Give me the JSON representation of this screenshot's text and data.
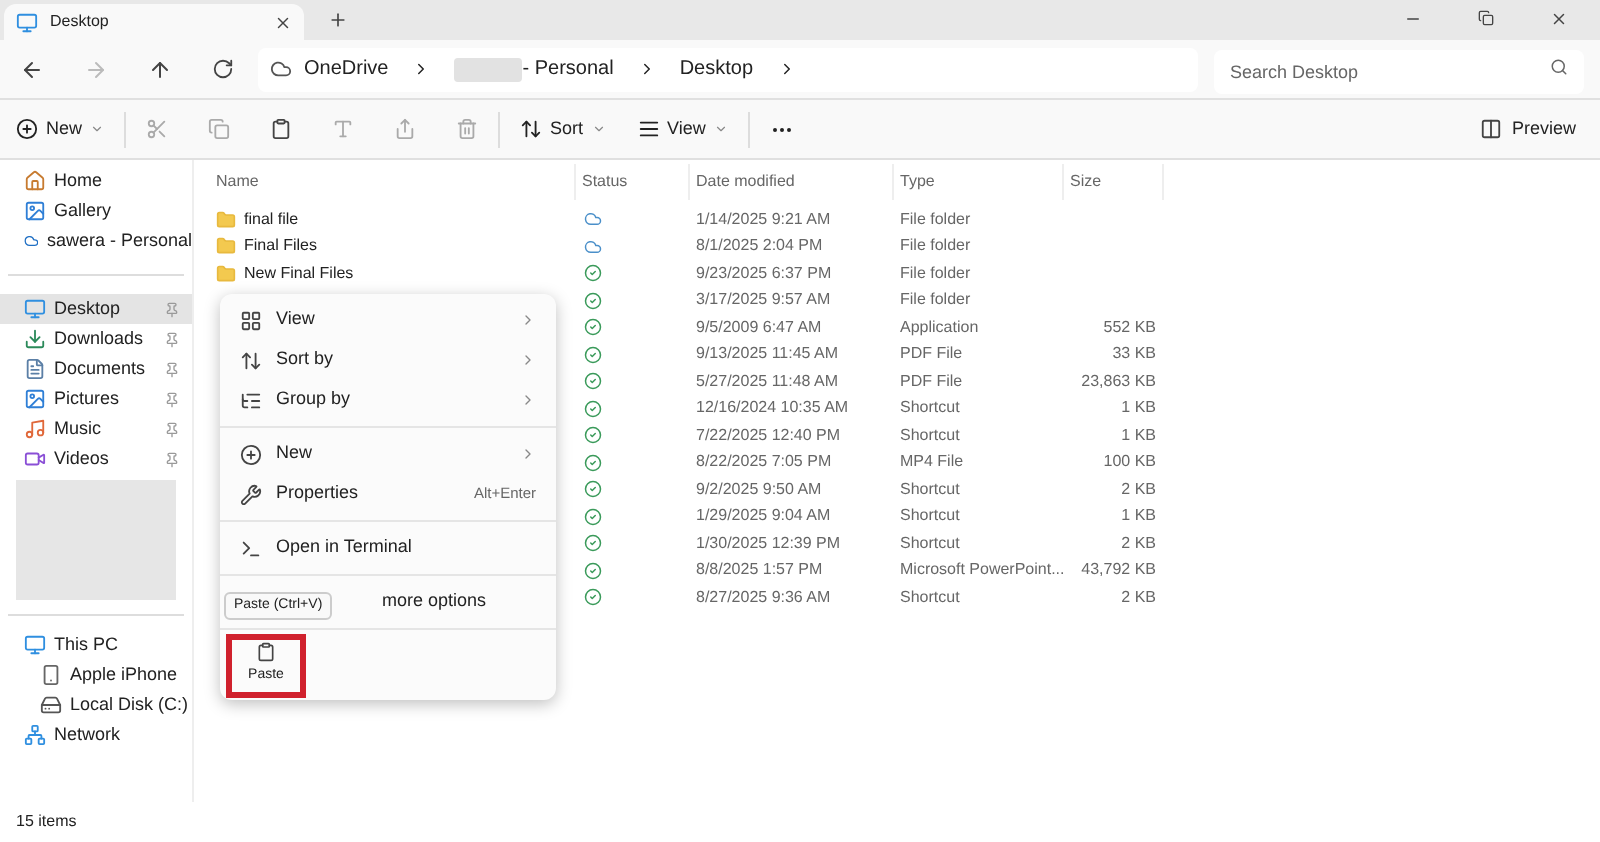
{
  "tabs": [
    {
      "label": "Desktop",
      "selected": true
    }
  ],
  "address": {
    "crumbs": [
      "OneDrive",
      "- Personal",
      "Desktop"
    ]
  },
  "search": {
    "placeholder": "Search Desktop"
  },
  "toolbar": {
    "new": "New",
    "sort": "Sort",
    "view": "View",
    "preview": "Preview"
  },
  "sidebar": {
    "top": [
      {
        "label": "Home",
        "kind": "home"
      },
      {
        "label": "Gallery",
        "kind": "gallery"
      },
      {
        "label": "sawera - Personal",
        "kind": "cloud"
      }
    ],
    "quick": [
      {
        "label": "Desktop",
        "kind": "desktop",
        "selected": true
      },
      {
        "label": "Downloads",
        "kind": "download",
        "selected": false
      },
      {
        "label": "Documents",
        "kind": "docs",
        "selected": false
      },
      {
        "label": "Pictures",
        "kind": "pictures",
        "selected": false
      },
      {
        "label": "Music",
        "kind": "music",
        "selected": false
      },
      {
        "label": "Videos",
        "kind": "videos",
        "selected": false
      }
    ],
    "bottom": [
      {
        "label": "This PC",
        "kind": "pc",
        "children": [
          {
            "label": "Apple iPhone",
            "kind": "phone"
          },
          {
            "label": "Local Disk (C:)",
            "kind": "disk"
          }
        ]
      },
      {
        "label": "Network",
        "kind": "network"
      }
    ]
  },
  "table": {
    "columns": [
      "Name",
      "Status",
      "Date modified",
      "Type",
      "Size"
    ],
    "rows": [
      {
        "name": "final file",
        "kind": "cloud",
        "date": "1/14/2025 9:21 AM",
        "type": "File folder"
      },
      {
        "name": "Final Files",
        "kind": "cloud",
        "date": "8/1/2025 2:04 PM",
        "type": "File folder"
      },
      {
        "name": "New Final Files",
        "kind": "synced",
        "date": "9/23/2025 6:37 PM",
        "type": "File folder"
      },
      {
        "kind": "synced",
        "date": "3/17/2025 9:57 AM",
        "type": "File folder"
      },
      {
        "kind": "synced",
        "date": "9/5/2009 6:47 AM",
        "type": "Application",
        "size": "552 KB"
      },
      {
        "kind": "synced",
        "date": "9/13/2025 11:45 AM",
        "type": "PDF File",
        "size": "33 KB"
      },
      {
        "kind": "synced",
        "date": "5/27/2025 11:48 AM",
        "type": "PDF File",
        "size": "23,863 KB"
      },
      {
        "kind": "synced",
        "date": "12/16/2024 10:35 AM",
        "type": "Shortcut",
        "size": "1 KB"
      },
      {
        "kind": "synced",
        "date": "7/22/2025 12:40 PM",
        "type": "Shortcut",
        "size": "1 KB"
      },
      {
        "kind": "synced",
        "date": "8/22/2025 7:05 PM",
        "type": "MP4 File",
        "size": "100 KB"
      },
      {
        "kind": "synced",
        "date": "9/2/2025 9:50 AM",
        "type": "Shortcut",
        "size": "2 KB"
      },
      {
        "kind": "synced",
        "date": "1/29/2025 9:04 AM",
        "type": "Shortcut",
        "size": "1 KB"
      },
      {
        "kind": "synced",
        "date": "1/30/2025 12:39 PM",
        "type": "Shortcut",
        "size": "2 KB"
      },
      {
        "kind": "synced",
        "date": "8/8/2025 1:57 PM",
        "type": "Microsoft PowerPoint...",
        "size": "43,792 KB"
      },
      {
        "kind": "synced",
        "date": "8/27/2025 9:36 AM",
        "type": "Shortcut",
        "size": "2 KB"
      }
    ]
  },
  "context_menu": {
    "groups": [
      [
        {
          "label": "View",
          "kind": "view",
          "submenu": true
        },
        {
          "label": "Sort by",
          "kind": "sort",
          "submenu": true
        },
        {
          "label": "Group by",
          "kind": "group",
          "submenu": true
        }
      ],
      [
        {
          "label": "New",
          "kind": "new",
          "submenu": true
        },
        {
          "label": "Properties",
          "kind": "props",
          "submenu": false,
          "shortcut": "Alt+Enter"
        }
      ],
      [
        {
          "label": "Open in Terminal",
          "kind": "terminal",
          "submenu": false
        }
      ],
      [
        {
          "label": "more options",
          "kind": "partial"
        }
      ]
    ],
    "tooltip": "Paste (Ctrl+V)",
    "paste": {
      "label": "Paste",
      "highlighted": true
    }
  },
  "status_bar": {
    "count": "15 items"
  }
}
